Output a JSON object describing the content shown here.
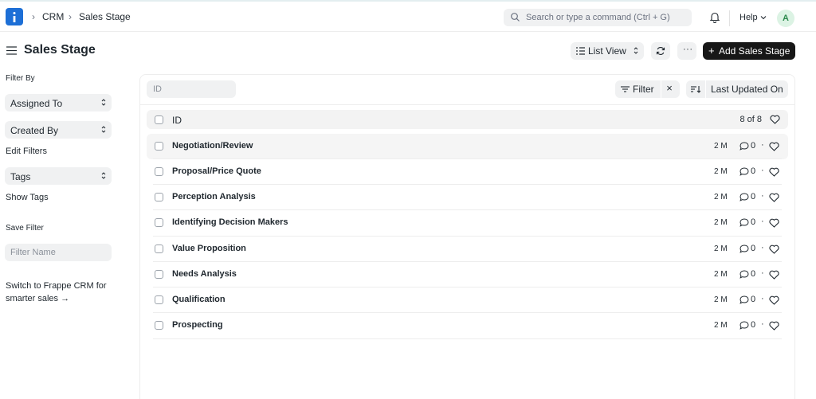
{
  "navbar": {
    "logo_icon": "frappe-logo-icon",
    "breadcrumbs": [
      "CRM",
      "Sales Stage"
    ],
    "search_placeholder": "Search or type a command (Ctrl + G)",
    "help_label": "Help",
    "avatar_initial": "A",
    "accent_color": "#1d6fd6"
  },
  "header": {
    "title": "Sales Stage",
    "list_view_label": "List View",
    "more_label": "···",
    "add_label": "Add Sales Stage"
  },
  "sidebar": {
    "filter_by": "Filter By",
    "assigned_to": "Assigned To",
    "created_by": "Created By",
    "edit_filters": "Edit Filters",
    "tags": "Tags",
    "show_tags": "Show Tags",
    "save_filter": "Save Filter",
    "filter_name_placeholder": "Filter Name",
    "switch_crm": "Switch to Frappe CRM for smarter sales →"
  },
  "toolbar": {
    "id_placeholder": "ID",
    "filter_label": "Filter",
    "clear_label": "×",
    "sort_label": "Last Updated On"
  },
  "list": {
    "header_label": "ID",
    "count": "8 of 8",
    "rows": [
      {
        "name": "Negotiation/Review",
        "modified": "2 M",
        "comments": "0"
      },
      {
        "name": "Proposal/Price Quote",
        "modified": "2 M",
        "comments": "0"
      },
      {
        "name": "Perception Analysis",
        "modified": "2 M",
        "comments": "0"
      },
      {
        "name": "Identifying Decision Makers",
        "modified": "2 M",
        "comments": "0"
      },
      {
        "name": "Value Proposition",
        "modified": "2 M",
        "comments": "0"
      },
      {
        "name": "Needs Analysis",
        "modified": "2 M",
        "comments": "0"
      },
      {
        "name": "Qualification",
        "modified": "2 M",
        "comments": "0"
      },
      {
        "name": "Prospecting",
        "modified": "2 M",
        "comments": "0"
      }
    ]
  }
}
